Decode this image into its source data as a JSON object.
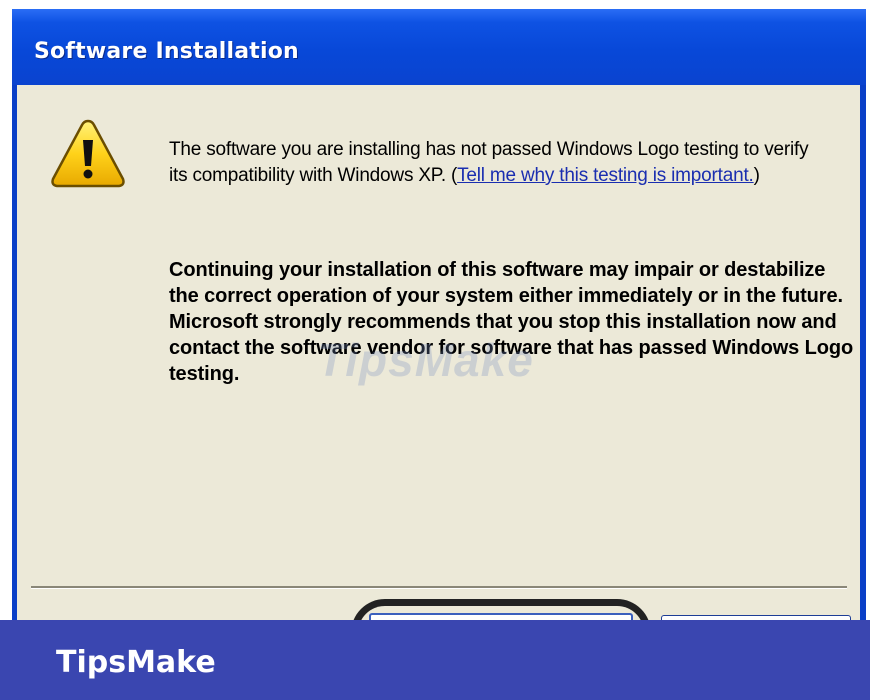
{
  "window": {
    "title": "Software Installation"
  },
  "dialog": {
    "icon": "warning-icon",
    "message_part1": "The software you are installing has not passed Windows Logo testing to verify its compatibility with Windows XP. (",
    "link_text": "Tell me why this testing is important.",
    "message_part1_end": ")",
    "warning_text": "Continuing your installation of this software may impair or destabilize the correct operation of your system either immediately or in the future. Microsoft strongly recommends that you stop this installation now and contact the software vendor for software that has passed Windows Logo testing."
  },
  "watermark": {
    "text": "TipsMake"
  },
  "branding": {
    "text": "TipsMake"
  },
  "colors": {
    "titlebar": "#0848d8",
    "client_bg": "#ece9d8",
    "brand_bar": "#3a46b0",
    "link": "#1a2eb0"
  }
}
